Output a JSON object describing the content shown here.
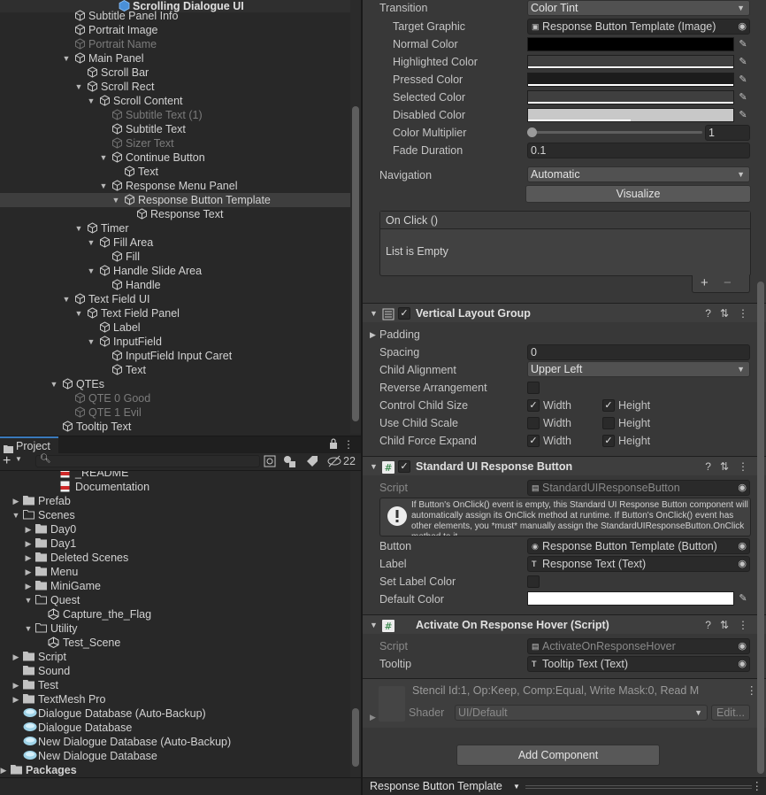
{
  "hierarchy": {
    "title": "Scrolling Dialogue UI",
    "items": [
      {
        "label": "Subtitle Panel Info",
        "depth": 5,
        "arrow": "",
        "dim": false,
        "sel": false
      },
      {
        "label": "Portrait Image",
        "depth": 5,
        "arrow": "",
        "dim": false,
        "sel": false
      },
      {
        "label": "Portrait Name",
        "depth": 5,
        "arrow": "",
        "dim": true,
        "sel": false
      },
      {
        "label": "Main Panel",
        "depth": 5,
        "arrow": "down",
        "dim": false,
        "sel": false
      },
      {
        "label": "Scroll Bar",
        "depth": 6,
        "arrow": "",
        "dim": false,
        "sel": false
      },
      {
        "label": "Scroll Rect",
        "depth": 6,
        "arrow": "down",
        "dim": false,
        "sel": false
      },
      {
        "label": "Scroll Content",
        "depth": 7,
        "arrow": "down",
        "dim": false,
        "sel": false
      },
      {
        "label": "Subtitle Text (1)",
        "depth": 8,
        "arrow": "",
        "dim": true,
        "sel": false
      },
      {
        "label": "Subtitle Text",
        "depth": 8,
        "arrow": "",
        "dim": false,
        "sel": false
      },
      {
        "label": "Sizer Text",
        "depth": 8,
        "arrow": "",
        "dim": true,
        "sel": false
      },
      {
        "label": "Continue Button",
        "depth": 8,
        "arrow": "down",
        "dim": false,
        "sel": false
      },
      {
        "label": "Text",
        "depth": 9,
        "arrow": "",
        "dim": false,
        "sel": false
      },
      {
        "label": "Response Menu Panel",
        "depth": 8,
        "arrow": "down",
        "dim": false,
        "sel": false
      },
      {
        "label": "Response Button Template",
        "depth": 9,
        "arrow": "down",
        "dim": false,
        "sel": true
      },
      {
        "label": "Response Text",
        "depth": 10,
        "arrow": "",
        "dim": false,
        "sel": false
      },
      {
        "label": "Timer",
        "depth": 6,
        "arrow": "down",
        "dim": false,
        "sel": false
      },
      {
        "label": "Fill Area",
        "depth": 7,
        "arrow": "down",
        "dim": false,
        "sel": false
      },
      {
        "label": "Fill",
        "depth": 8,
        "arrow": "",
        "dim": false,
        "sel": false
      },
      {
        "label": "Handle Slide Area",
        "depth": 7,
        "arrow": "down",
        "dim": false,
        "sel": false
      },
      {
        "label": "Handle",
        "depth": 8,
        "arrow": "",
        "dim": false,
        "sel": false
      },
      {
        "label": "Text Field UI",
        "depth": 5,
        "arrow": "down",
        "dim": false,
        "sel": false
      },
      {
        "label": "Text Field Panel",
        "depth": 6,
        "arrow": "down",
        "dim": false,
        "sel": false
      },
      {
        "label": "Label",
        "depth": 7,
        "arrow": "",
        "dim": false,
        "sel": false
      },
      {
        "label": "InputField",
        "depth": 7,
        "arrow": "down",
        "dim": false,
        "sel": false
      },
      {
        "label": "InputField Input Caret",
        "depth": 8,
        "arrow": "",
        "dim": false,
        "sel": false
      },
      {
        "label": "Text",
        "depth": 8,
        "arrow": "",
        "dim": false,
        "sel": false
      },
      {
        "label": "QTEs",
        "depth": 4,
        "arrow": "down",
        "dim": false,
        "sel": false
      },
      {
        "label": "QTE 0 Good",
        "depth": 5,
        "arrow": "",
        "dim": true,
        "sel": false
      },
      {
        "label": "QTE 1 Evil",
        "depth": 5,
        "arrow": "",
        "dim": true,
        "sel": false
      },
      {
        "label": "Tooltip Text",
        "depth": 4,
        "arrow": "",
        "dim": false,
        "sel": false
      }
    ]
  },
  "project": {
    "tab_label": "Project",
    "hidden_count": "22",
    "items": [
      {
        "label": "_README",
        "depth": 4,
        "arrow": "",
        "type": "pdf"
      },
      {
        "label": "Documentation",
        "depth": 4,
        "arrow": "",
        "type": "pdf"
      },
      {
        "label": "Prefab",
        "depth": 1,
        "arrow": "right",
        "type": "folder"
      },
      {
        "label": "Scenes",
        "depth": 1,
        "arrow": "down",
        "type": "folder"
      },
      {
        "label": "Day0",
        "depth": 2,
        "arrow": "right",
        "type": "folder"
      },
      {
        "label": "Day1",
        "depth": 2,
        "arrow": "right",
        "type": "folder"
      },
      {
        "label": "Deleted Scenes",
        "depth": 2,
        "arrow": "right",
        "type": "folder"
      },
      {
        "label": "Menu",
        "depth": 2,
        "arrow": "right",
        "type": "folder"
      },
      {
        "label": "MiniGame",
        "depth": 2,
        "arrow": "right",
        "type": "folder"
      },
      {
        "label": "Quest",
        "depth": 2,
        "arrow": "down",
        "type": "folder"
      },
      {
        "label": "Capture_the_Flag",
        "depth": 3,
        "arrow": "",
        "type": "scene"
      },
      {
        "label": "Utility",
        "depth": 2,
        "arrow": "down",
        "type": "folder"
      },
      {
        "label": "Test_Scene",
        "depth": 3,
        "arrow": "",
        "type": "scene"
      },
      {
        "label": "Script",
        "depth": 1,
        "arrow": "right",
        "type": "folder"
      },
      {
        "label": "Sound",
        "depth": 1,
        "arrow": "",
        "type": "folder"
      },
      {
        "label": "Test",
        "depth": 1,
        "arrow": "right",
        "type": "folder"
      },
      {
        "label": "TextMesh Pro",
        "depth": 1,
        "arrow": "right",
        "type": "folder"
      },
      {
        "label": "Dialogue Database (Auto-Backup)",
        "depth": 1,
        "arrow": "",
        "type": "db"
      },
      {
        "label": "Dialogue Database",
        "depth": 1,
        "arrow": "",
        "type": "db"
      },
      {
        "label": "New Dialogue Database (Auto-Backup)",
        "depth": 1,
        "arrow": "",
        "type": "db"
      },
      {
        "label": "New Dialogue Database",
        "depth": 1,
        "arrow": "",
        "type": "db"
      },
      {
        "label": "Packages",
        "depth": 0,
        "arrow": "right",
        "type": "folder"
      }
    ]
  },
  "button": {
    "transition_label": "Transition",
    "transition_value": "Color Tint",
    "target_graphic_label": "Target Graphic",
    "target_graphic_value": "Response Button Template (Image)",
    "colors": [
      {
        "label": "Normal Color",
        "color": "#000000",
        "bar": false
      },
      {
        "label": "Highlighted Color",
        "color": "#3f3f3f",
        "bar": true
      },
      {
        "label": "Pressed Color",
        "color": "#1c1c1c",
        "bar": true
      },
      {
        "label": "Selected Color",
        "color": "#3f3f3f",
        "bar": true
      },
      {
        "label": "Disabled Color",
        "color": "#c8c8c8",
        "bar": true
      }
    ],
    "color_multiplier_label": "Color Multiplier",
    "color_multiplier_value": "1",
    "fade_duration_label": "Fade Duration",
    "fade_duration_value": "0.1",
    "navigation_label": "Navigation",
    "navigation_value": "Automatic",
    "visualize_label": "Visualize",
    "onclick_label": "On Click ()",
    "list_empty_label": "List is Empty"
  },
  "layout_group": {
    "title": "Vertical Layout Group",
    "padding_label": "Padding",
    "spacing_label": "Spacing",
    "spacing_value": "0",
    "child_alignment_label": "Child Alignment",
    "child_alignment_value": "Upper Left",
    "reverse_label": "Reverse Arrangement",
    "control_size_label": "Control Child Size",
    "use_scale_label": "Use Child Scale",
    "force_expand_label": "Child Force Expand",
    "width_label": "Width",
    "height_label": "Height"
  },
  "response_button": {
    "title": "Standard UI Response Button",
    "script_label": "Script",
    "script_value": "StandardUIResponseButton",
    "info_text": "If Button's OnClick() event is empty, this Standard UI Response Button component will automatically assign its OnClick method at runtime. If Button's OnClick() event has other elements, you *must* manually assign the StandardUIResponseButton.OnClick method to it.",
    "button_label": "Button",
    "button_value": "Response Button Template (Button)",
    "label_label": "Label",
    "label_value": "Response Text (Text)",
    "set_label_color_label": "Set Label Color",
    "default_color_label": "Default Color",
    "default_color": "#ffffff"
  },
  "hover": {
    "title": "Activate On Response Hover (Script)",
    "script_label": "Script",
    "script_value": "ActivateOnResponseHover",
    "tooltip_label": "Tooltip",
    "tooltip_value": "Tooltip Text (Text)"
  },
  "material": {
    "stencil_text": "Stencil Id:1, Op:Keep, Comp:Equal, Write Mask:0, Read M",
    "shader_label": "Shader",
    "shader_value": "UI/Default",
    "edit_label": "Edit..."
  },
  "add_component_label": "Add Component",
  "footer_label": "Response Button Template"
}
